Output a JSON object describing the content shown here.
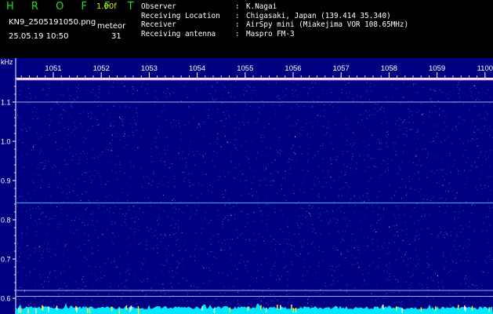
{
  "header": {
    "app_title": "H R O F F T",
    "version": "1.00f",
    "filename": "KN9_2505191050.png",
    "mode": "meteor",
    "datetime": "25.05.19 10:50",
    "count": "31",
    "meta": [
      {
        "key": "Observer",
        "sep": ":",
        "value": "K.Nagai"
      },
      {
        "key": "Receiving Location",
        "sep": ":",
        "value": "Chigasaki, Japan (139.414 35.340)"
      },
      {
        "key": "Receiver",
        "sep": ":",
        "value": "AirSpy mini (Miakejima VOR 108.65MHz)"
      },
      {
        "key": "Receiving antenna",
        "sep": ":",
        "value": "Maspro FM-3"
      }
    ]
  },
  "spectrogram": {
    "y_unit": "kHz",
    "y_ticks": [
      "1.1",
      "1.0",
      "0.9",
      "0.8",
      "0.7",
      "0.6"
    ],
    "y_tick_values": [
      1.1,
      1.0,
      0.9,
      0.8,
      0.7,
      0.6
    ],
    "x_ticks": [
      "1051",
      "1052",
      "1053",
      "1054",
      "1055",
      "1056",
      "1057",
      "1058",
      "1059",
      "1100"
    ],
    "lines_khz": [
      1.158,
      1.1,
      0.843,
      0.62,
      0.605
    ],
    "colors": {
      "background": "#000080",
      "noise": "#4b5cff",
      "carrier": "#ffd0ff",
      "line": "#22d8ff",
      "bottom_bar": "#00e8ff",
      "axis": "#ffffff"
    }
  }
}
